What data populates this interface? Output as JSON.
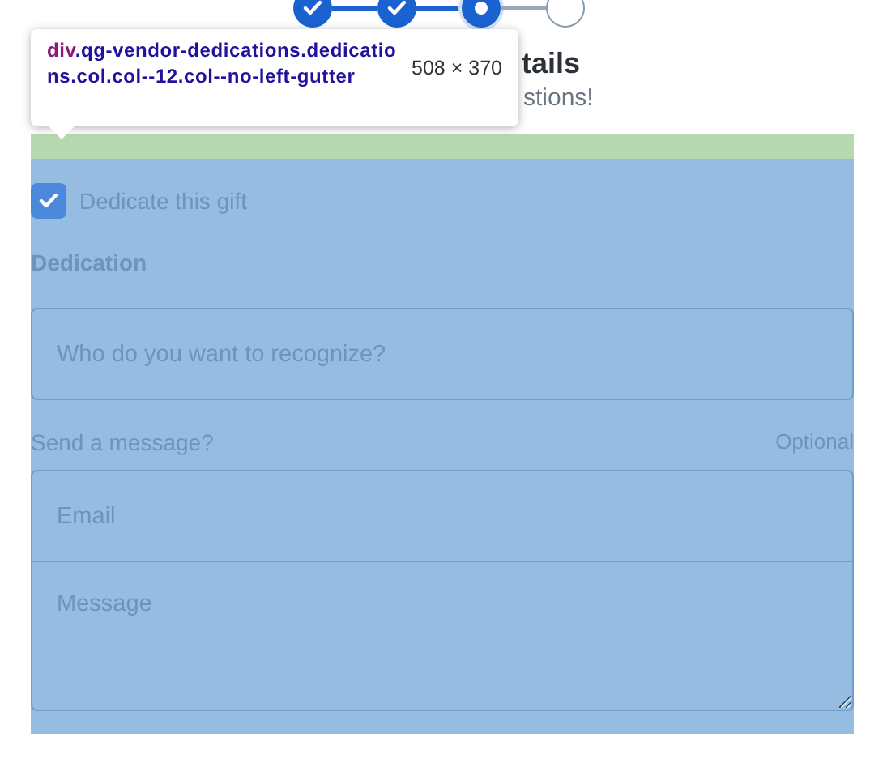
{
  "stepper": [
    {
      "done": true,
      "current": false
    },
    {
      "done": true,
      "current": false
    },
    {
      "done": false,
      "current": true
    },
    {
      "done": false,
      "current": false
    }
  ],
  "heading": "tails",
  "subheading": "stions!",
  "inspector_tooltip": {
    "tag": "div",
    "selector": ".qg-vendor-dedications.dedications.col.col--12.col--no-left-gutter",
    "size": "508 × 370"
  },
  "dedication_form": {
    "checkbox": {
      "label": "Dedicate this gift",
      "checked": true
    },
    "section_label": "Dedication",
    "recipient_field": {
      "placeholder": "Who do you want to recognize?"
    },
    "message_label": "Send a message?",
    "message_hint": "Optional",
    "email_field": {
      "placeholder": "Email"
    },
    "message_field": {
      "placeholder": "Message"
    }
  }
}
